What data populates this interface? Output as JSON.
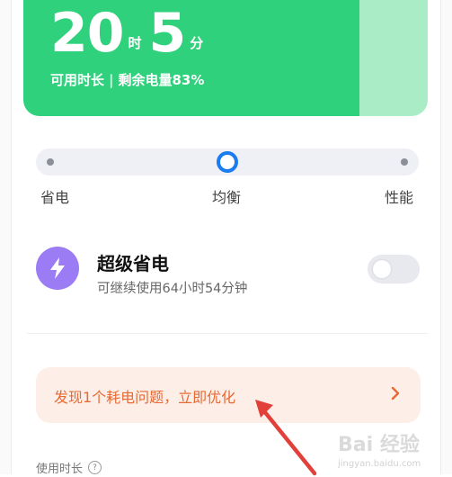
{
  "battery": {
    "hours": "20",
    "hours_unit": "时",
    "minutes": "5",
    "minutes_unit": "分",
    "available_label": "可用时长",
    "remaining_label": "剩余电量83%",
    "remaining_percent": 83,
    "fill_color": "#2fd17c",
    "track_color": "#a9ecc5"
  },
  "mode_selector": {
    "options": [
      "省电",
      "均衡",
      "性能"
    ],
    "selected": "均衡",
    "accent_color": "#1a7cf0"
  },
  "super_save": {
    "icon": "lightning-icon",
    "title": "超级省电",
    "subtitle": "可继续使用64小时54分钟",
    "enabled": false,
    "icon_color": "#9b7cf5"
  },
  "optimize": {
    "text": "发现1个耗电问题，立即优化",
    "chevron": "chevron-right-icon",
    "text_color": "#e66a34"
  },
  "usage": {
    "label": "使用时长",
    "help_icon": "question-icon",
    "help_glyph": "?"
  },
  "watermark": {
    "main": "Bai 经验",
    "sub": "jingyan.baidu.com"
  }
}
